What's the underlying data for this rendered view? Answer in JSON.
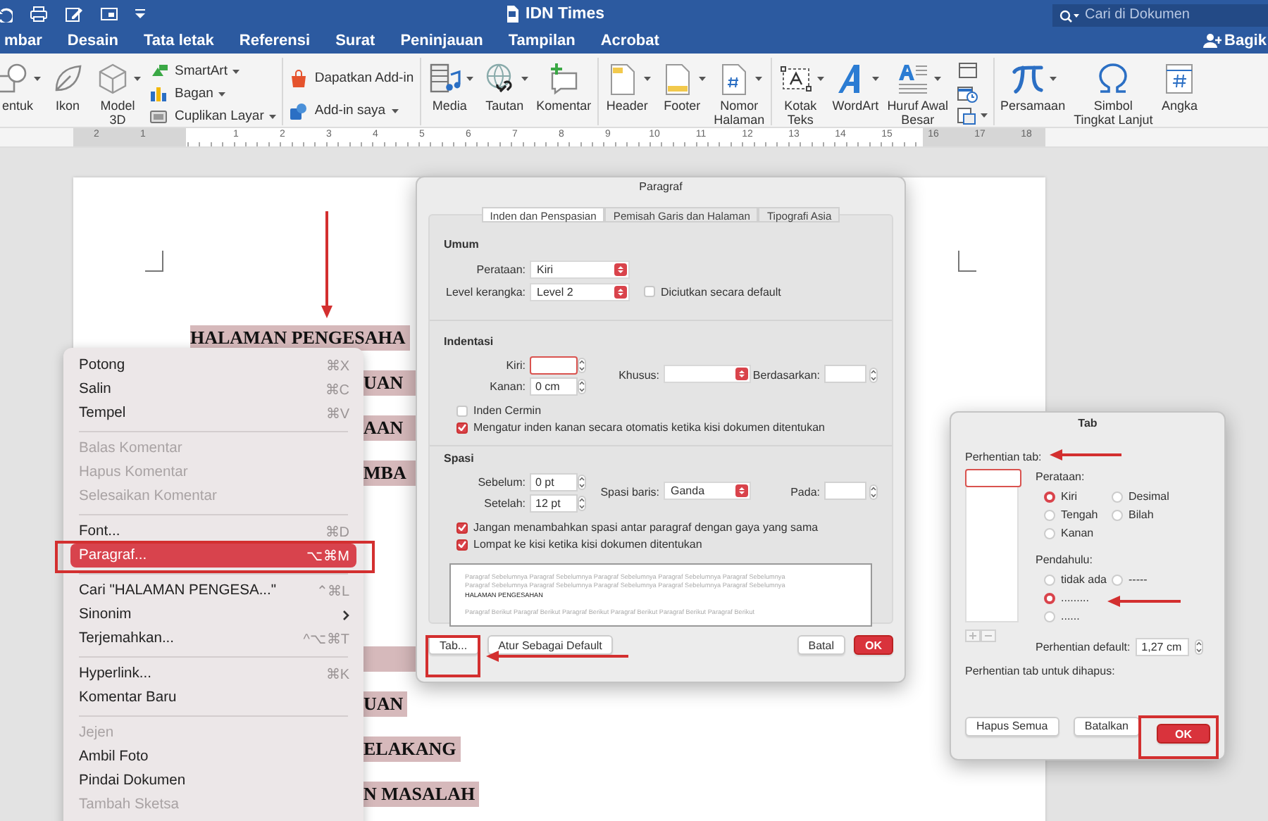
{
  "title_bar": {
    "title": "IDN Times",
    "search": {
      "placeholder": "Cari di Dokumen"
    }
  },
  "tabs": [
    {
      "label": "mbar"
    },
    {
      "label": "Desain"
    },
    {
      "label": "Tata letak"
    },
    {
      "label": "Referensi"
    },
    {
      "label": "Surat"
    },
    {
      "label": "Peninjauan"
    },
    {
      "label": "Tampilan"
    },
    {
      "label": "Acrobat"
    }
  ],
  "share_button": {
    "label": "Bagik"
  },
  "ribbon": {
    "groups": [
      {
        "items": [
          {
            "kind": "large",
            "lines": [
              "entuk"
            ],
            "dropdown": true
          },
          {
            "kind": "large",
            "lines": [
              "Ikon"
            ],
            "dropdown": false
          },
          {
            "kind": "large",
            "lines": [
              "Model",
              "3D"
            ],
            "dropdown": true
          },
          {
            "kind": "stack",
            "items": [
              {
                "label": "SmartArt",
                "dropdown": true
              },
              {
                "label": "Bagan",
                "dropdown": true
              },
              {
                "label": "Cuplikan Layar",
                "dropdown": true
              }
            ]
          }
        ]
      },
      {
        "items": [
          {
            "kind": "stack",
            "items": [
              {
                "label": "Dapatkan Add-in",
                "dropdown": false
              },
              {
                "label": "Add-in saya",
                "dropdown": true
              }
            ]
          }
        ]
      },
      {
        "items": [
          {
            "kind": "large",
            "lines": [
              "Media"
            ],
            "dropdown": true
          },
          {
            "kind": "large",
            "lines": [
              "Tautan"
            ],
            "dropdown": true
          },
          {
            "kind": "large",
            "lines": [
              "Komentar"
            ],
            "dropdown": false
          }
        ]
      },
      {
        "items": [
          {
            "kind": "large",
            "lines": [
              "Header"
            ],
            "dropdown": true
          },
          {
            "kind": "large",
            "lines": [
              "Footer"
            ],
            "dropdown": true
          },
          {
            "kind": "large",
            "lines": [
              "Nomor",
              "Halaman"
            ],
            "dropdown": true
          }
        ]
      },
      {
        "items": [
          {
            "kind": "large",
            "lines": [
              "Kotak",
              "Teks"
            ],
            "dropdown": true
          },
          {
            "kind": "large",
            "lines": [
              "WordArt"
            ],
            "dropdown": true
          },
          {
            "kind": "large",
            "lines": [
              "Huruf Awal",
              "Besar"
            ],
            "dropdown": true
          },
          {
            "kind": "icon_stack",
            "items": [
              {
                "dropdown": false
              },
              {
                "dropdown": false
              },
              {
                "dropdown": true
              }
            ]
          }
        ]
      },
      {
        "items": [
          {
            "kind": "large",
            "lines": [
              "Persamaan"
            ],
            "dropdown": true
          },
          {
            "kind": "large",
            "lines": [
              "Simbol",
              "Tingkat Lanjut"
            ],
            "dropdown": false
          },
          {
            "kind": "large",
            "lines": [
              "Angka"
            ],
            "dropdown": false
          }
        ]
      }
    ]
  },
  "ruler": {
    "numbers": [
      "2",
      "1",
      "1",
      "2",
      "3",
      "4",
      "5",
      "6",
      "7",
      "8",
      "9",
      "10",
      "11",
      "12",
      "13",
      "14",
      "15",
      "16",
      "17",
      "18"
    ]
  },
  "document": {
    "top_lines": [
      "HALAMAN PENGESAHA",
      "UAN",
      "AAN",
      "MBA"
    ],
    "bottom_lines": [
      "UAN",
      "ELAKANG",
      "N MASALAH"
    ]
  },
  "context_menu": {
    "items": [
      {
        "kind": "item",
        "label": "Potong",
        "shortcut": "⌘X",
        "disabled": false,
        "selected": false,
        "submenu": false
      },
      {
        "kind": "item",
        "label": "Salin",
        "shortcut": "⌘C",
        "disabled": false,
        "selected": false,
        "submenu": false
      },
      {
        "kind": "item",
        "label": "Tempel",
        "shortcut": "⌘V",
        "disabled": false,
        "selected": false,
        "submenu": false
      },
      {
        "kind": "separator"
      },
      {
        "kind": "item",
        "label": "Balas Komentar",
        "disabled": true,
        "selected": false,
        "submenu": false
      },
      {
        "kind": "item",
        "label": "Hapus Komentar",
        "disabled": true,
        "selected": false,
        "submenu": false
      },
      {
        "kind": "item",
        "label": "Selesaikan Komentar",
        "disabled": true,
        "selected": false,
        "submenu": false
      },
      {
        "kind": "separator"
      },
      {
        "kind": "item",
        "label": "Font...",
        "shortcut": "⌘D",
        "disabled": false,
        "selected": false,
        "submenu": false
      },
      {
        "kind": "item",
        "label": "Paragraf...",
        "shortcut": "⌥⌘M",
        "disabled": false,
        "selected": true,
        "submenu": false
      },
      {
        "kind": "separator"
      },
      {
        "kind": "item",
        "label": "Cari \"HALAMAN PENGESA...\"",
        "shortcut": "⌃⌘L",
        "disabled": false,
        "selected": false,
        "submenu": false
      },
      {
        "kind": "item",
        "label": "Sinonim",
        "disabled": false,
        "selected": false,
        "submenu": true
      },
      {
        "kind": "item",
        "label": "Terjemahkan...",
        "shortcut": "^⌥⌘T",
        "disabled": false,
        "selected": false,
        "submenu": false
      },
      {
        "kind": "separator"
      },
      {
        "kind": "item",
        "label": "Hyperlink...",
        "shortcut": "⌘K",
        "disabled": false,
        "selected": false,
        "submenu": false
      },
      {
        "kind": "item",
        "label": "Komentar Baru",
        "disabled": false,
        "selected": false,
        "submenu": false
      },
      {
        "kind": "separator"
      },
      {
        "kind": "item",
        "label": "Jejen",
        "disabled": true,
        "selected": false,
        "submenu": false
      },
      {
        "kind": "item",
        "label": "Ambil Foto",
        "disabled": false,
        "selected": false,
        "submenu": false
      },
      {
        "kind": "item",
        "label": "Pindai Dokumen",
        "disabled": false,
        "selected": false,
        "submenu": false
      },
      {
        "kind": "item",
        "label": "Tambah Sketsa",
        "disabled": true,
        "selected": false,
        "submenu": false
      }
    ]
  },
  "paragraph_dialog": {
    "title": "Paragraf",
    "tabs": [
      {
        "label": "Inden dan Penspasian",
        "selected": true
      },
      {
        "label": "Pemisah Garis dan Halaman",
        "selected": false
      },
      {
        "label": "Tipografi Asia",
        "selected": false
      }
    ],
    "umum": {
      "heading": "Umum",
      "alignment": {
        "label": "Perataan:",
        "value": "Kiri"
      },
      "outline_level": {
        "label": "Level kerangka:",
        "value": "Level 2"
      },
      "collapsed": {
        "label": "Diciutkan secara default",
        "checked": false
      }
    },
    "indentasi": {
      "heading": "Indentasi",
      "left": {
        "label": "Kiri:",
        "focused": true
      },
      "right": {
        "label": "Kanan:",
        "value": "0 cm",
        "focused": false
      },
      "special": {
        "label": "Khusus:"
      },
      "by": {
        "label": "Berdasarkan:",
        "focused": false
      },
      "checkboxes": [
        {
          "label": "Inden Cermin",
          "checked": false
        },
        {
          "label": "Mengatur inden kanan secara otomatis ketika kisi dokumen ditentukan",
          "checked": true
        }
      ]
    },
    "spasi": {
      "heading": "Spasi",
      "before": {
        "label": "Sebelum:",
        "value": "0 pt",
        "focused": false
      },
      "after": {
        "label": "Setelah:",
        "value": "12 pt",
        "focused": false
      },
      "line_spacing": {
        "label": "Spasi baris:",
        "value": "Ganda"
      },
      "at": {
        "label": "Pada:",
        "focused": false
      },
      "checkboxes": [
        {
          "label": "Jangan menambahkan spasi antar paragraf dengan gaya yang sama",
          "checked": true
        },
        {
          "label": "Lompat ke kisi ketika kisi dokumen ditentukan",
          "checked": true
        }
      ]
    },
    "preview": [
      {
        "kind": "previous",
        "text": "Paragraf Sebelumnya Paragraf Sebelumnya Paragraf Sebelumnya Paragraf Sebelumnya Paragraf Sebelumnya"
      },
      {
        "kind": "previous",
        "text": "Paragraf Sebelumnya Paragraf Sebelumnya Paragraf Sebelumnya Paragraf Sebelumnya Paragraf Sebelumnya"
      },
      {
        "kind": "current",
        "text": "HALAMAN PENGESAHAN"
      },
      {
        "kind": "next",
        "text": "Paragraf Berikut Paragraf Berikut Paragraf Berikut Paragraf Berikut Paragraf Berikut Paragraf Berikut"
      }
    ],
    "buttons": [
      {
        "label": "Tab...",
        "default": false
      },
      {
        "label": "Atur Sebagai Default",
        "default": false
      },
      {
        "label": "Batal",
        "default": false
      },
      {
        "label": "OK",
        "default": true
      }
    ]
  },
  "tab_dialog": {
    "title": "Tab",
    "stops_label": "Perhentian tab:",
    "alignment_label": "Perataan:",
    "alignment": [
      {
        "label": "Kiri",
        "selected": true
      },
      {
        "label": "Desimal",
        "selected": false
      },
      {
        "label": "Tengah",
        "selected": false
      },
      {
        "label": "Bilah",
        "selected": false
      },
      {
        "label": "Kanan",
        "selected": false
      }
    ],
    "leader_label": "Pendahulu:",
    "leaders": [
      {
        "label": "tidak ada",
        "selected": false
      },
      {
        "label": "-----",
        "selected": false
      },
      {
        "label": ".........",
        "selected": true
      },
      {
        "label": "......",
        "selected": false
      }
    ],
    "default_stop": {
      "label": "Perhentian default:",
      "value": "1,27 cm"
    },
    "clear_label": "Perhentian tab untuk dihapus:",
    "buttons": [
      {
        "label": "Hapus Semua",
        "default": false
      },
      {
        "label": "Batalkan",
        "default": false
      },
      {
        "label": "OK",
        "default": true
      }
    ]
  }
}
